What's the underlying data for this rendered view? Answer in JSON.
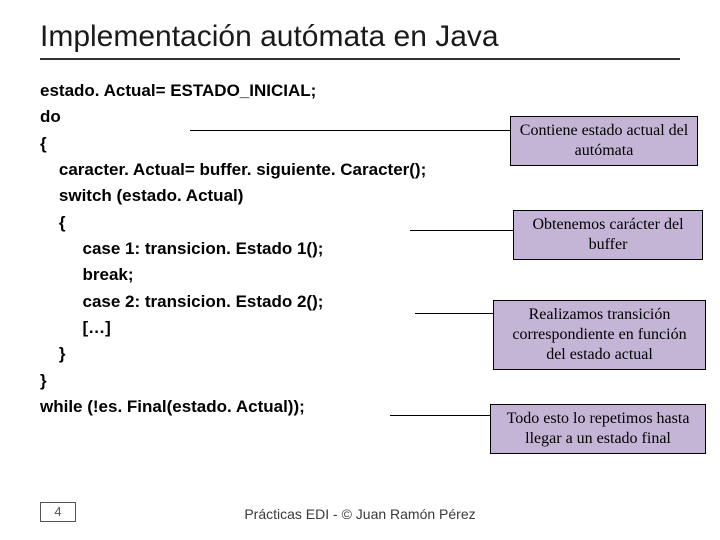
{
  "title": "Implementación autómata en Java",
  "code_lines": {
    "l1": "estado. Actual= ESTADO_INICIAL;",
    "l2": "do",
    "l3": "{",
    "l4": "    caracter. Actual= buffer. siguiente. Caracter();",
    "l5": "    switch (estado. Actual)",
    "l6": "    {",
    "l7": "         case 1: transicion. Estado 1();",
    "l8": "         break;",
    "l9": "         case 2: transicion. Estado 2();",
    "l10": "         […]",
    "l11": "    }",
    "l12": "}",
    "l13": "while (!es. Final(estado. Actual));"
  },
  "callouts": {
    "c1": "Contiene estado\nactual del autómata",
    "c2": "Obtenemos carácter\ndel buffer",
    "c3": "Realizamos transición\ncorrespondiente en\nfunción del estado actual",
    "c4": "Todo esto lo repetimos\nhasta llegar a un\nestado final"
  },
  "footer": {
    "page": "4",
    "text": "Prácticas EDI - © Juan Ramón Pérez"
  }
}
